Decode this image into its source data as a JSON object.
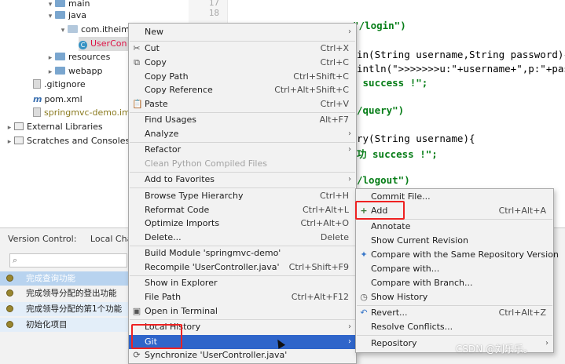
{
  "project_tree": [
    {
      "label": "main",
      "kind": "folder",
      "arrow": "▾"
    },
    {
      "label": "java",
      "kind": "folder",
      "arrow": "▾"
    },
    {
      "label": "com.itheim",
      "kind": "package",
      "arrow": "▾"
    },
    {
      "label": "UserCon",
      "kind": "class",
      "arrow": ""
    },
    {
      "label": "resources",
      "kind": "folder",
      "arrow": "▸"
    },
    {
      "label": "webapp",
      "kind": "folder",
      "arrow": "▸"
    },
    {
      "label": ".gitignore",
      "kind": "file",
      "arrow": ""
    },
    {
      "label": "pom.xml",
      "kind": "maven",
      "arrow": ""
    },
    {
      "label": "springmvc-demo.iml",
      "kind": "file",
      "arrow": ""
    },
    {
      "label": "External Libraries",
      "kind": "library",
      "arrow": "▸"
    },
    {
      "label": "Scratches and Consoles",
      "kind": "scratch",
      "arrow": "▸"
    }
  ],
  "gutter": {
    "line_17": "17",
    "line_18": "18"
  },
  "code_lines": [
    "\"/login\")",
    "in(String username,String password){",
    "intln(\">>>>>>>u:\"+username+\",p:\"+pas",
    " success !\";",
    "/query\")",
    "ry(String username){",
    "功 success !\";",
    "/logout\")"
  ],
  "version_control": {
    "tabs": [
      "Version Control:",
      "Local Chang"
    ],
    "search_placeholder": "",
    "commits": [
      "完成查询功能",
      "完成领导分配的登出功能",
      "完成领导分配的第1个功能",
      "初始化项目"
    ]
  },
  "main_menu": [
    {
      "label": "New",
      "shortcut": "",
      "arrow": "›",
      "icon": ""
    },
    {
      "label": "Cut",
      "shortcut": "Ctrl+X",
      "arrow": "",
      "icon": "✂"
    },
    {
      "label": "Copy",
      "shortcut": "Ctrl+C",
      "arrow": "",
      "icon": "⧉"
    },
    {
      "label": "Copy Path",
      "shortcut": "Ctrl+Shift+C",
      "arrow": "",
      "icon": ""
    },
    {
      "label": "Copy Reference",
      "shortcut": "Ctrl+Alt+Shift+C",
      "arrow": "",
      "icon": ""
    },
    {
      "label": "Paste",
      "shortcut": "Ctrl+V",
      "arrow": "",
      "icon": "📋"
    },
    {
      "label": "Find Usages",
      "shortcut": "Alt+F7",
      "arrow": "",
      "icon": ""
    },
    {
      "label": "Analyze",
      "shortcut": "",
      "arrow": "›",
      "icon": ""
    },
    {
      "label": "Refactor",
      "shortcut": "",
      "arrow": "›",
      "icon": ""
    },
    {
      "label": "Clean Python Compiled Files",
      "shortcut": "",
      "arrow": "",
      "icon": ""
    },
    {
      "label": "Add to Favorites",
      "shortcut": "",
      "arrow": "›",
      "icon": ""
    },
    {
      "label": "Browse Type Hierarchy",
      "shortcut": "Ctrl+H",
      "arrow": "",
      "icon": ""
    },
    {
      "label": "Reformat Code",
      "shortcut": "Ctrl+Alt+L",
      "arrow": "",
      "icon": ""
    },
    {
      "label": "Optimize Imports",
      "shortcut": "Ctrl+Alt+O",
      "arrow": "",
      "icon": ""
    },
    {
      "label": "Delete...",
      "shortcut": "Delete",
      "arrow": "",
      "icon": ""
    },
    {
      "label": "Build Module 'springmvc-demo'",
      "shortcut": "",
      "arrow": "",
      "icon": ""
    },
    {
      "label": "Recompile 'UserController.java'",
      "shortcut": "Ctrl+Shift+F9",
      "arrow": "",
      "icon": ""
    },
    {
      "label": "Show in Explorer",
      "shortcut": "",
      "arrow": "",
      "icon": ""
    },
    {
      "label": "File Path",
      "shortcut": "Ctrl+Alt+F12",
      "arrow": "",
      "icon": ""
    },
    {
      "label": "Open in Terminal",
      "shortcut": "",
      "arrow": "",
      "icon": "▣"
    },
    {
      "label": "Local History",
      "shortcut": "",
      "arrow": "›",
      "icon": ""
    },
    {
      "label": "Git",
      "shortcut": "",
      "arrow": "›",
      "icon": ""
    },
    {
      "label": "Synchronize 'UserController.java'",
      "shortcut": "",
      "arrow": "",
      "icon": "⟳"
    }
  ],
  "git_submenu": [
    {
      "label": "Commit File...",
      "shortcut": "",
      "icon": ""
    },
    {
      "label": "Add",
      "shortcut": "Ctrl+Alt+A",
      "icon": "+"
    },
    {
      "label": "Annotate",
      "shortcut": "",
      "icon": ""
    },
    {
      "label": "Show Current Revision",
      "shortcut": "",
      "icon": ""
    },
    {
      "label": "Compare with the Same Repository Version",
      "shortcut": "",
      "icon": "✦"
    },
    {
      "label": "Compare with...",
      "shortcut": "",
      "icon": ""
    },
    {
      "label": "Compare with Branch...",
      "shortcut": "",
      "icon": ""
    },
    {
      "label": "Show History",
      "shortcut": "",
      "icon": "◷"
    },
    {
      "label": "Revert...",
      "shortcut": "Ctrl+Alt+Z",
      "icon": "↶"
    },
    {
      "label": "Resolve Conflicts...",
      "shortcut": "",
      "icon": ""
    },
    {
      "label": "Repository",
      "shortcut": "",
      "icon": "",
      "arrow": "›"
    }
  ],
  "watermark": "CSDN @刘乐乐。",
  "colors": {
    "highlight": "#2f65ca",
    "annotation": "#e22222",
    "menu_bg": "#f2f2f2"
  }
}
